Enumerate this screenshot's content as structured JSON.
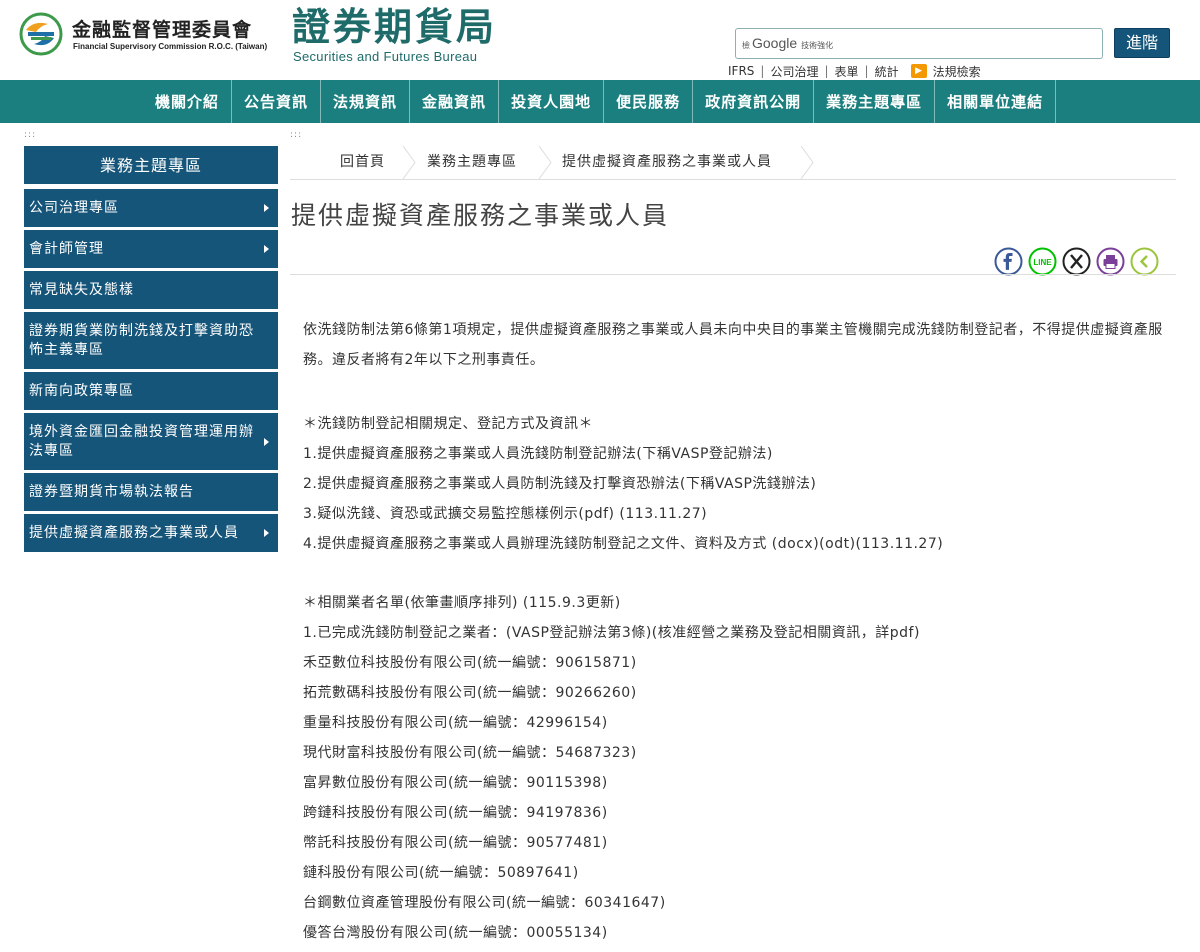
{
  "header": {
    "fsc_name": "金融監督管理委員會",
    "fsc_english": "Financial Supervisory Commission R.O.C. (Taiwan)",
    "bureau_name": "證券期貨局",
    "bureau_english": "Securities and Futures Bureau",
    "search": {
      "brand_prefix": "檢",
      "brand_google": "Google",
      "brand_suffix": "技術強化",
      "placeholder": "",
      "button_label": "進階"
    },
    "util_links": [
      "IFRS",
      "公司治理",
      "表單",
      "統計"
    ],
    "law_search_label": "法規檢索"
  },
  "nav": {
    "items": [
      "機關介紹",
      "公告資訊",
      "法規資訊",
      "金融資訊",
      "投資人園地",
      "便民服務",
      "政府資訊公開",
      "業務主題專區",
      "相關單位連結"
    ]
  },
  "accesskey_marker": ":::",
  "sidebar": {
    "header": "業務主題專區",
    "items": [
      {
        "label": "公司治理專區",
        "has_arrow": true
      },
      {
        "label": "會計師管理",
        "has_arrow": true
      },
      {
        "label": "常見缺失及態樣",
        "has_arrow": false
      },
      {
        "label": "證券期貨業防制洗錢及打擊資助恐怖主義專區",
        "has_arrow": false
      },
      {
        "label": "新南向政策專區",
        "has_arrow": false
      },
      {
        "label": "境外資金匯回金融投資管理運用辦法專區",
        "has_arrow": true
      },
      {
        "label": "證券暨期貨市場執法報告",
        "has_arrow": false
      },
      {
        "label": "提供虛擬資產服務之事業或人員",
        "has_arrow": true
      }
    ]
  },
  "breadcrumb": [
    "回首頁",
    "業務主題專區",
    "提供虛擬資產服務之事業或人員"
  ],
  "page_title": "提供虛擬資產服務之事業或人員",
  "share": [
    "facebook-icon",
    "line-icon",
    "x-icon",
    "print-icon",
    "back-icon"
  ],
  "article": {
    "intro": "依洗錢防制法第6條第1項規定，提供虛擬資產服務之事業或人員未向中央目的事業主管機關完成洗錢防制登記者，不得提供虛擬資產服務。違反者將有2年以下之刑事責任。",
    "section1_heading": "＊洗錢防制登記相關規定、登記方式及資訊＊",
    "section1_items": [
      "1.提供虛擬資產服務之事業或人員洗錢防制登記辦法(下稱VASP登記辦法)",
      "2.提供虛擬資產服務之事業或人員防制洗錢及打擊資恐辦法(下稱VASP洗錢辦法)",
      "3.疑似洗錢、資恐或武擴交易監控態樣例示(pdf) (113.11.27)",
      "4.提供虛擬資產服務之事業或人員辦理洗錢防制登記之文件、資料及方式 (docx)(odt)(113.11.27)"
    ],
    "section2_heading": "＊相關業者名單(依筆畫順序排列) (115.9.3更新)",
    "section2_sub": "1.已完成洗錢防制登記之業者：(VASP登記辦法第3條)(核准經營之業務及登記相關資訊，詳pdf)",
    "companies": [
      "禾亞數位科技股份有限公司(統一編號：90615871)",
      "拓荒數碼科技股份有限公司(統一編號：90266260)",
      "重量科技股份有限公司(統一編號：42996154)",
      "現代財富科技股份有限公司(統一編號：54687323)",
      "富昇數位股份有限公司(統一編號：90115398)",
      "跨鏈科技股份有限公司(統一編號：94197836)",
      "幣託科技股份有限公司(統一編號：90577481)",
      "鏈科股份有限公司(統一編號：50897641)",
      "台鋼數位資產管理股份有限公司(統一編號：60341647)",
      "優答台灣股份有限公司(統一編號：00055134)"
    ]
  },
  "colors": {
    "nav_teal": "#1a7f7e",
    "sidebar_blue": "#16557a",
    "bureau_green": "#1e6b6a",
    "facebook": "#3b5998",
    "line": "#00c300",
    "x": "#222222",
    "print": "#7a3f98",
    "back": "#9bc53d"
  }
}
